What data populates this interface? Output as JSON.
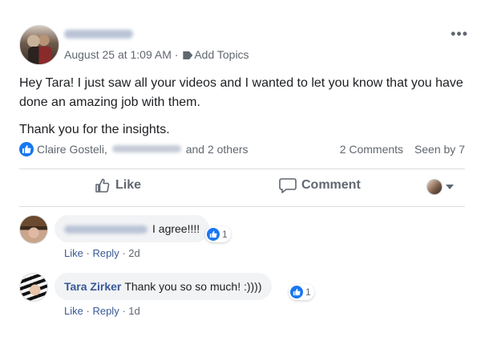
{
  "post": {
    "meta_date": "August 25 at 1:09 AM",
    "meta_sep": "·",
    "meta_topics": "Add Topics",
    "more_label": "•••",
    "paragraphs": [
      "Hey Tara! I just saw all your videos and I wanted to let you know that you have done an amazing job with them.",
      "Thank you for the insights."
    ]
  },
  "reactions": {
    "first_name": "Claire Gosteli,",
    "rest": "and 2 others",
    "comments": "2 Comments",
    "seen": "Seen by 7"
  },
  "actions": {
    "like": "Like",
    "comment": "Comment"
  },
  "comments": [
    {
      "author": "",
      "text": "I agree!!!!",
      "reaction_count": "1",
      "like": "Like",
      "sep": "·",
      "reply": "Reply",
      "time": "2d"
    },
    {
      "author": "Tara Zirker",
      "text": "Thank you so so much! :))))",
      "reaction_count": "1",
      "like": "Like",
      "sep": "·",
      "reply": "Reply",
      "time": "1d"
    }
  ],
  "colors": {
    "accent": "#1877f2",
    "link": "#385898",
    "muted": "#606770",
    "bubble": "#f2f3f5"
  }
}
